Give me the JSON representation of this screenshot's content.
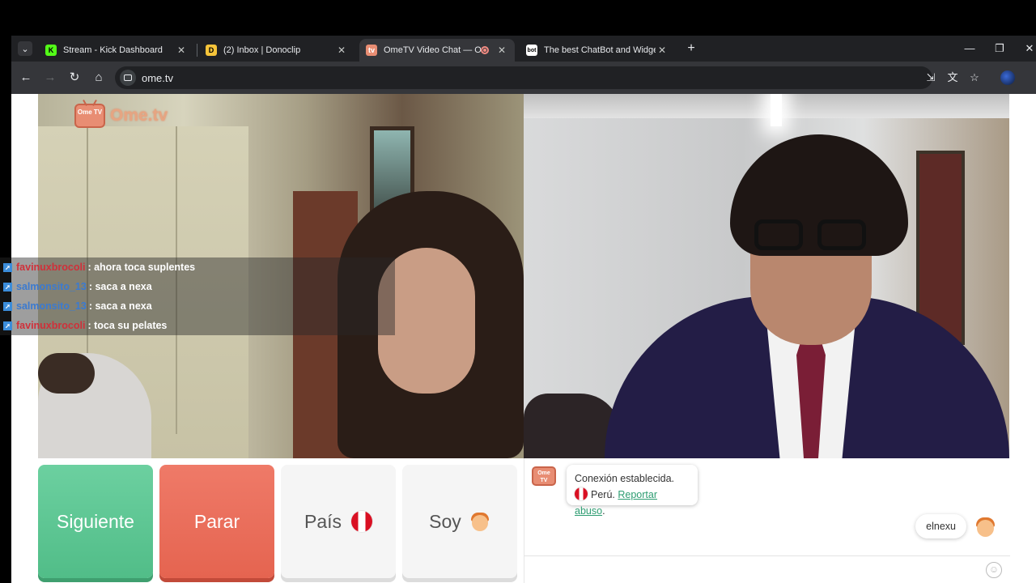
{
  "browser": {
    "tabs": [
      {
        "title": "Stream - Kick Dashboard",
        "favicon": "K"
      },
      {
        "title": "(2) Inbox | Donoclip",
        "favicon": "D"
      },
      {
        "title": "OmeTV Video Chat — Ome",
        "favicon": "tv"
      },
      {
        "title": "The best ChatBot and Widgets",
        "favicon": "bot"
      }
    ],
    "url": "ome.tv"
  },
  "logo": {
    "text": "Ome.tv",
    "icon_text": "Ome TV"
  },
  "stream_chat": [
    {
      "user": "favinuxbrocoli",
      "message": ": ahora toca suplentes",
      "color": "#d0303a"
    },
    {
      "user": "salmonsito_13",
      "message": ": saca a nexa",
      "color": "#3b7ad0"
    },
    {
      "user": "salmonsito_13",
      "message": ": saca a nexa",
      "color": "#3b7ad0"
    },
    {
      "user": "favinuxbrocoli",
      "message": ": toca su pelates",
      "color": "#d0303a"
    }
  ],
  "controls": {
    "next_label": "Siguiente",
    "stop_label": "Parar",
    "country_label": "País",
    "gender_label": "Soy"
  },
  "chat": {
    "system_message": "Conexión establecida.",
    "country": "Perú.",
    "report_link": "Reportar abuso",
    "my_message": "elnexu"
  },
  "colors": {
    "next": "#5ac693",
    "stop": "#e96e5b",
    "link": "#2e9d72"
  }
}
